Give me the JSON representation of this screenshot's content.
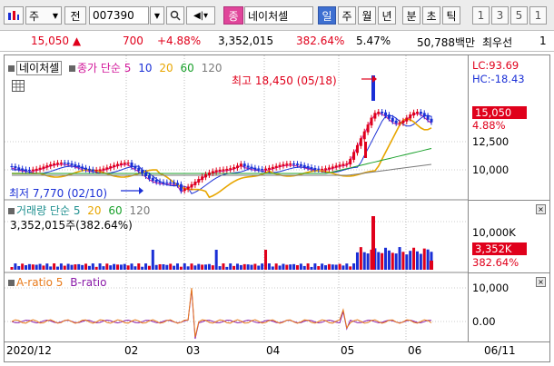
{
  "toolbar": {
    "market_label": "주",
    "market_mode": "전",
    "code": "007390",
    "badge": "종",
    "stock_name": "네이처셀",
    "periods": [
      "일",
      "주",
      "월",
      "년",
      "분",
      "초",
      "틱"
    ],
    "active_period": "일",
    "intervals": [
      "1",
      "3",
      "5",
      "1"
    ]
  },
  "quote": {
    "price": "15,050",
    "change": "700",
    "change_pct": "+4.88%",
    "volume": "3,352,015",
    "volume_ratio": "382.64%",
    "turnover": "5.47%",
    "amount": "50,788백만",
    "best_label": "최우선",
    "best_value": "1"
  },
  "price_panel": {
    "legend_name": "네이처셀",
    "legend_ma": "종가 단순 5",
    "ma_periods": [
      "10",
      "20",
      "60",
      "120"
    ],
    "high_note": "최고 18,450 (05/18)",
    "low_note": "최저 7,770 (02/10)",
    "lc": "LC:93.69",
    "hc": "HC:-18.43",
    "current_tag": "15,050",
    "current_pct": "4.88%",
    "y_labels": [
      "12,500",
      "10,000"
    ]
  },
  "volume_panel": {
    "legend": "거래량 단순 5",
    "ma_periods": [
      "20",
      "60",
      "120"
    ],
    "value_text": "3,352,015주(382.64%)",
    "y_label": "10,000K",
    "current_tag": "3,352K",
    "current_pct": "382.64%"
  },
  "ratio_panel": {
    "legend_a": "A-ratio 5",
    "legend_b": "B-ratio",
    "y_labels": [
      "10,000",
      "0.00"
    ]
  },
  "x_axis": {
    "labels": [
      "2020/12",
      "02",
      "03",
      "04",
      "05",
      "06"
    ],
    "end_date": "06/11"
  },
  "colors": {
    "up": "#e0001b",
    "down": "#1a2fd6",
    "ma5": "#d2179a",
    "ma10": "#1a2fd6",
    "ma20": "#e8a600",
    "ma60": "#18a02a",
    "ma120": "#7a7a7a",
    "volume_legend": "#1e8f8f",
    "a_ratio": "#e87a1a",
    "b_ratio": "#8a1aa8"
  }
}
